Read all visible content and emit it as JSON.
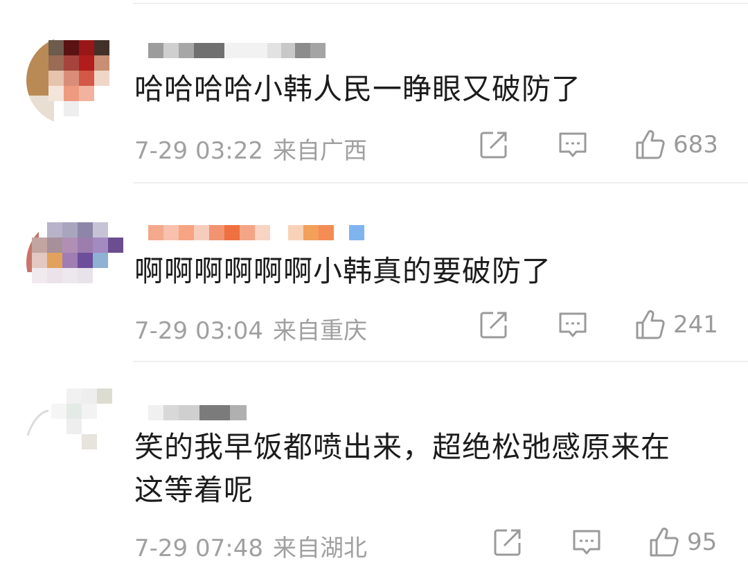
{
  "comments": [
    {
      "text": "哈哈哈哈小韩人民一睁眼又破防了",
      "time": "7-29 03:22",
      "location": "来自广西",
      "likes": "683"
    },
    {
      "text": "啊啊啊啊啊啊小韩真的要破防了",
      "time": "7-29 03:04",
      "location": "来自重庆",
      "likes": "241"
    },
    {
      "text_line1": "笑的我早饭都喷出来，超绝松弛感原来在",
      "text_line2": "这等着呢",
      "time": "7-29 07:48",
      "location": "来自湖北",
      "likes": "95"
    }
  ],
  "icons": {
    "share": "share-icon",
    "reply": "comment-icon",
    "like": "thumbs-up-icon"
  },
  "colors": {
    "text": "#1c1c1c",
    "meta": "#a0a0a0",
    "divider": "#efefef"
  }
}
